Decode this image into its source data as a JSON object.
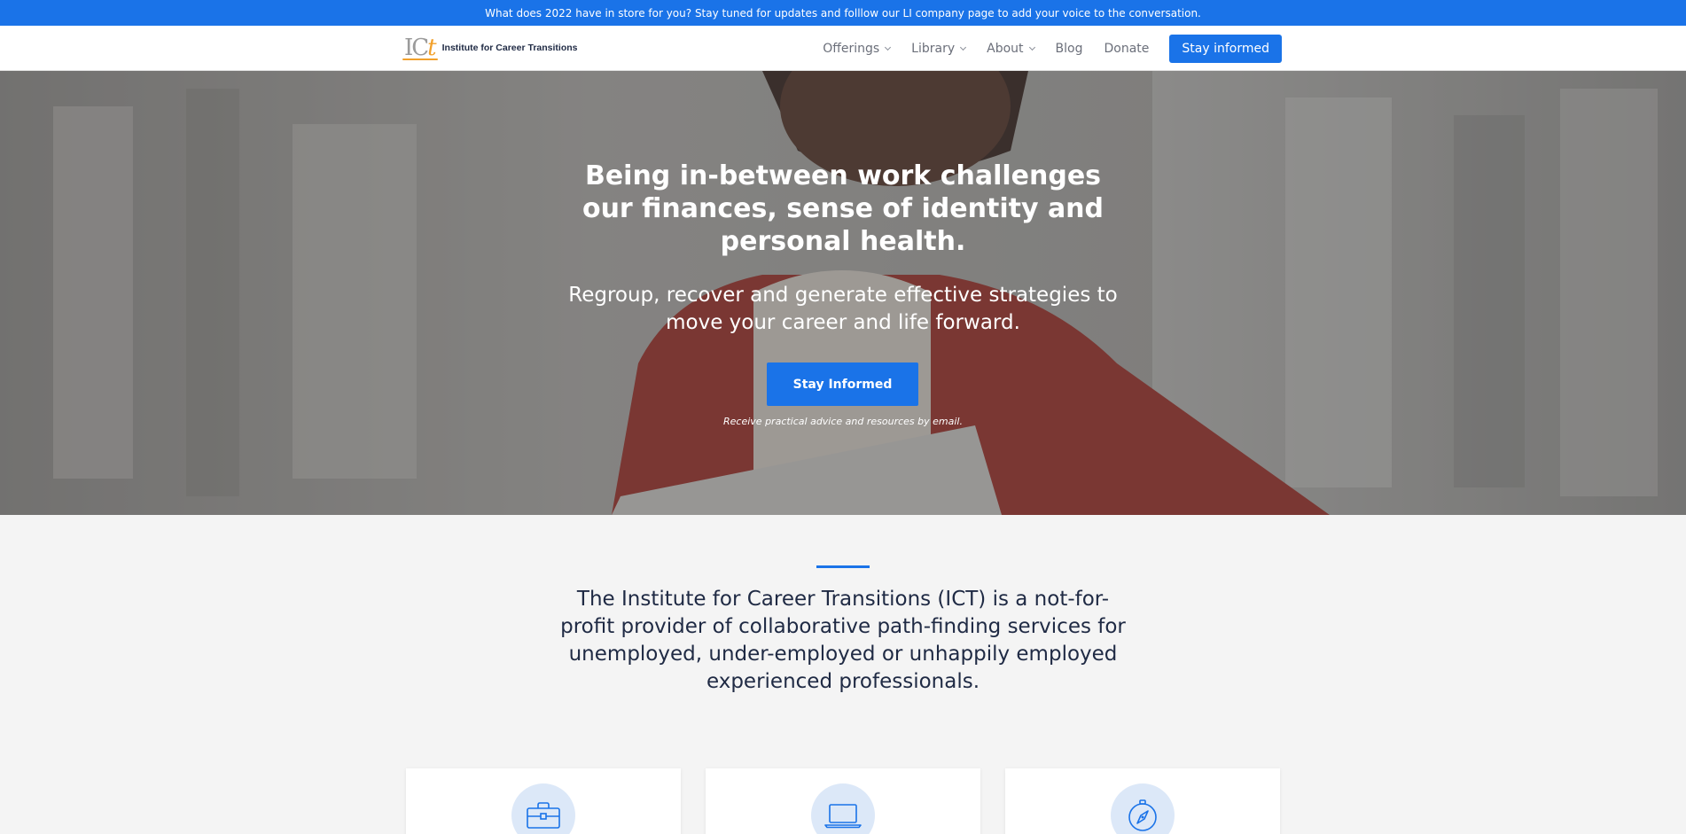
{
  "announcement": "What does 2022 have in store for you? Stay tuned for updates and folllow our LI company page to add your voice to the conversation.",
  "logo": {
    "mark_letters": "IC",
    "mark_accent": "t",
    "name": "Institute for Career Transitions"
  },
  "nav": {
    "items": [
      {
        "label": "Offerings",
        "has_dropdown": true
      },
      {
        "label": "Library",
        "has_dropdown": true
      },
      {
        "label": "About",
        "has_dropdown": true
      },
      {
        "label": "Blog",
        "has_dropdown": false
      },
      {
        "label": "Donate",
        "has_dropdown": false
      }
    ],
    "cta": "Stay informed"
  },
  "hero": {
    "headline": "Being in-between work challenges our finances, sense of identity and personal health.",
    "subheadline": "Regroup, recover and generate effective strategies to move your career and life forward.",
    "cta": "Stay Informed",
    "note": "Receive practical advice and resources by email."
  },
  "about": {
    "mission": "The Institute for Career Transitions (ICT) is a not-for-profit provider of collaborative path-finding services for unemployed, under-employed or unhappily employed experienced professionals."
  },
  "cards": [
    {
      "icon": "briefcase-icon"
    },
    {
      "icon": "laptop-icon"
    },
    {
      "icon": "compass-icon"
    }
  ],
  "colors": {
    "brand_blue": "#1a73e8",
    "logo_orange": "#f2a02a",
    "text_dark": "#1f2a44"
  }
}
